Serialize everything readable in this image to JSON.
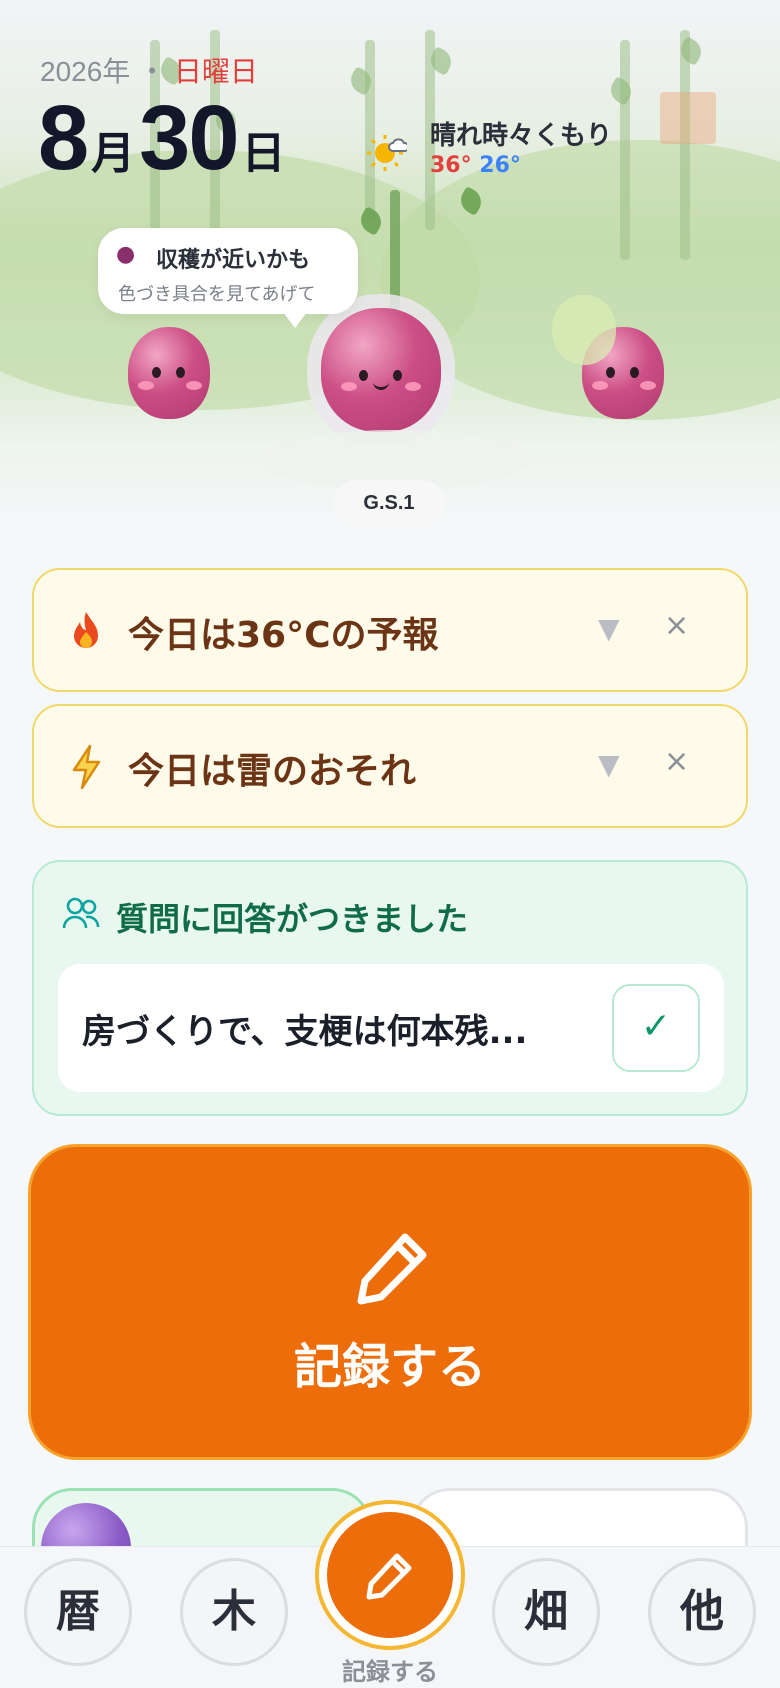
{
  "header": {
    "year": "2026年",
    "separator": "・",
    "day_of_week": "日曜日",
    "month": "8",
    "month_unit": "月",
    "day": "30",
    "day_unit": "日"
  },
  "weather": {
    "condition": "晴れ時々くもり",
    "high": "36°",
    "low": "26°"
  },
  "speech_bubble": {
    "title": "収穫が近いかも",
    "subtitle": "色づき具合を見てあげて"
  },
  "plant_tag": "G.S.1",
  "alerts": [
    {
      "text": "今日は36°Cの予報",
      "icon": "fire-icon"
    },
    {
      "text": "今日は雷のおそれ",
      "icon": "lightning-icon"
    }
  ],
  "alert_controls": {
    "expand": "▼",
    "close": "×"
  },
  "qa": {
    "title": "質問に回答がつきました",
    "question": "房づくりで、支梗は何本残...",
    "check": "✓"
  },
  "record_button": {
    "label": "記録する"
  },
  "nav": {
    "calendar": "暦",
    "tree": "木",
    "field": "畑",
    "other": "他",
    "center_label": "記録する"
  },
  "colors": {
    "accent": "#ec6d0a",
    "alert_border": "#f2d86a",
    "qa_green": "#0f6b4a",
    "sunday_red": "#e2403d",
    "low_temp_blue": "#3b82f6"
  }
}
